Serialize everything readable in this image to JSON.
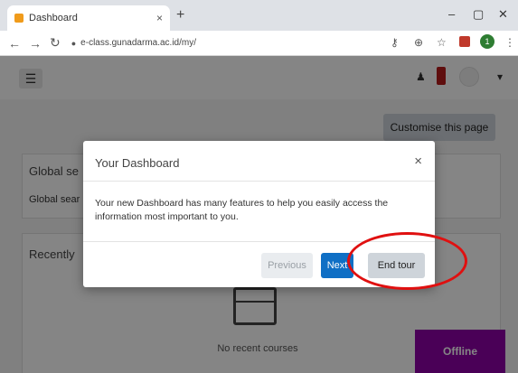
{
  "browser": {
    "tab_title": "Dashboard",
    "tab_close": "×",
    "new_tab": "+",
    "url": "e-class.gunadarma.ac.id/my/",
    "window_controls": [
      "–",
      "▢",
      "✕"
    ],
    "icons": [
      "back-arrow-icon",
      "forward-arrow-icon",
      "reload-icon",
      "lock-icon",
      "key-icon",
      "zoom-icon",
      "star-icon",
      "extension-icon",
      "profile-icon",
      "more-icon"
    ],
    "profile_initial": "1"
  },
  "page": {
    "menu_icon": "☰",
    "customise_label": "Customise this page",
    "global_block_title": "Global se",
    "global_block_sub": "Global sear",
    "recent_block_title": "Recently ",
    "empty_courses_text": "No recent courses",
    "offline_label": "Offline"
  },
  "tour": {
    "title": "Your Dashboard",
    "close": "×",
    "body": "Your new Dashboard has many features to help you easily access the information most important to you.",
    "previous_label": "Previous",
    "next_label": "Next",
    "end_label": "End tour",
    "highlight_color": "#e01010"
  },
  "colors": {
    "primary": "#0f6fc5",
    "offline_badge": "#8e00a8"
  }
}
